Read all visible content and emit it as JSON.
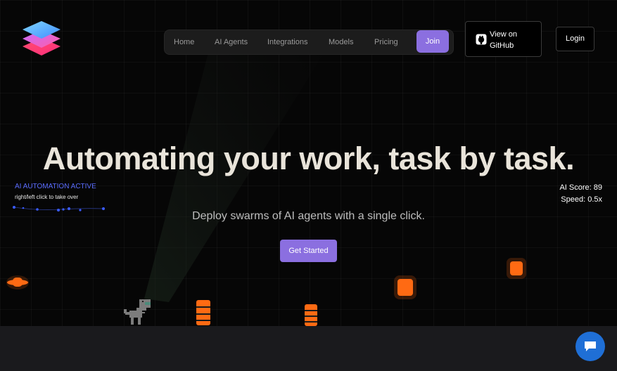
{
  "nav": {
    "items": [
      "Home",
      "AI Agents",
      "Integrations",
      "Models",
      "Pricing"
    ],
    "join_label": "Join"
  },
  "header": {
    "github_label": "View on GitHub",
    "login_label": "Login"
  },
  "hero": {
    "headline": "Automating your work, task by task.",
    "subline": "Deploy swarms of AI agents with a single click.",
    "cta_label": "Get Started"
  },
  "game": {
    "status": "AI AUTOMATION ACTIVE",
    "hint": "right/left click to take over",
    "score_label": "AI Score: 89",
    "speed_label": "Speed: 0.5x"
  },
  "colors": {
    "accent": "#8b6fe0",
    "obstacle": "#ff6a13",
    "status_blue": "#5a6cff",
    "chat_blue": "#1f6fd6"
  },
  "icons": {
    "logo": "layered-stack-logo",
    "github": "github-icon",
    "chat": "chat-bubble-icon"
  }
}
